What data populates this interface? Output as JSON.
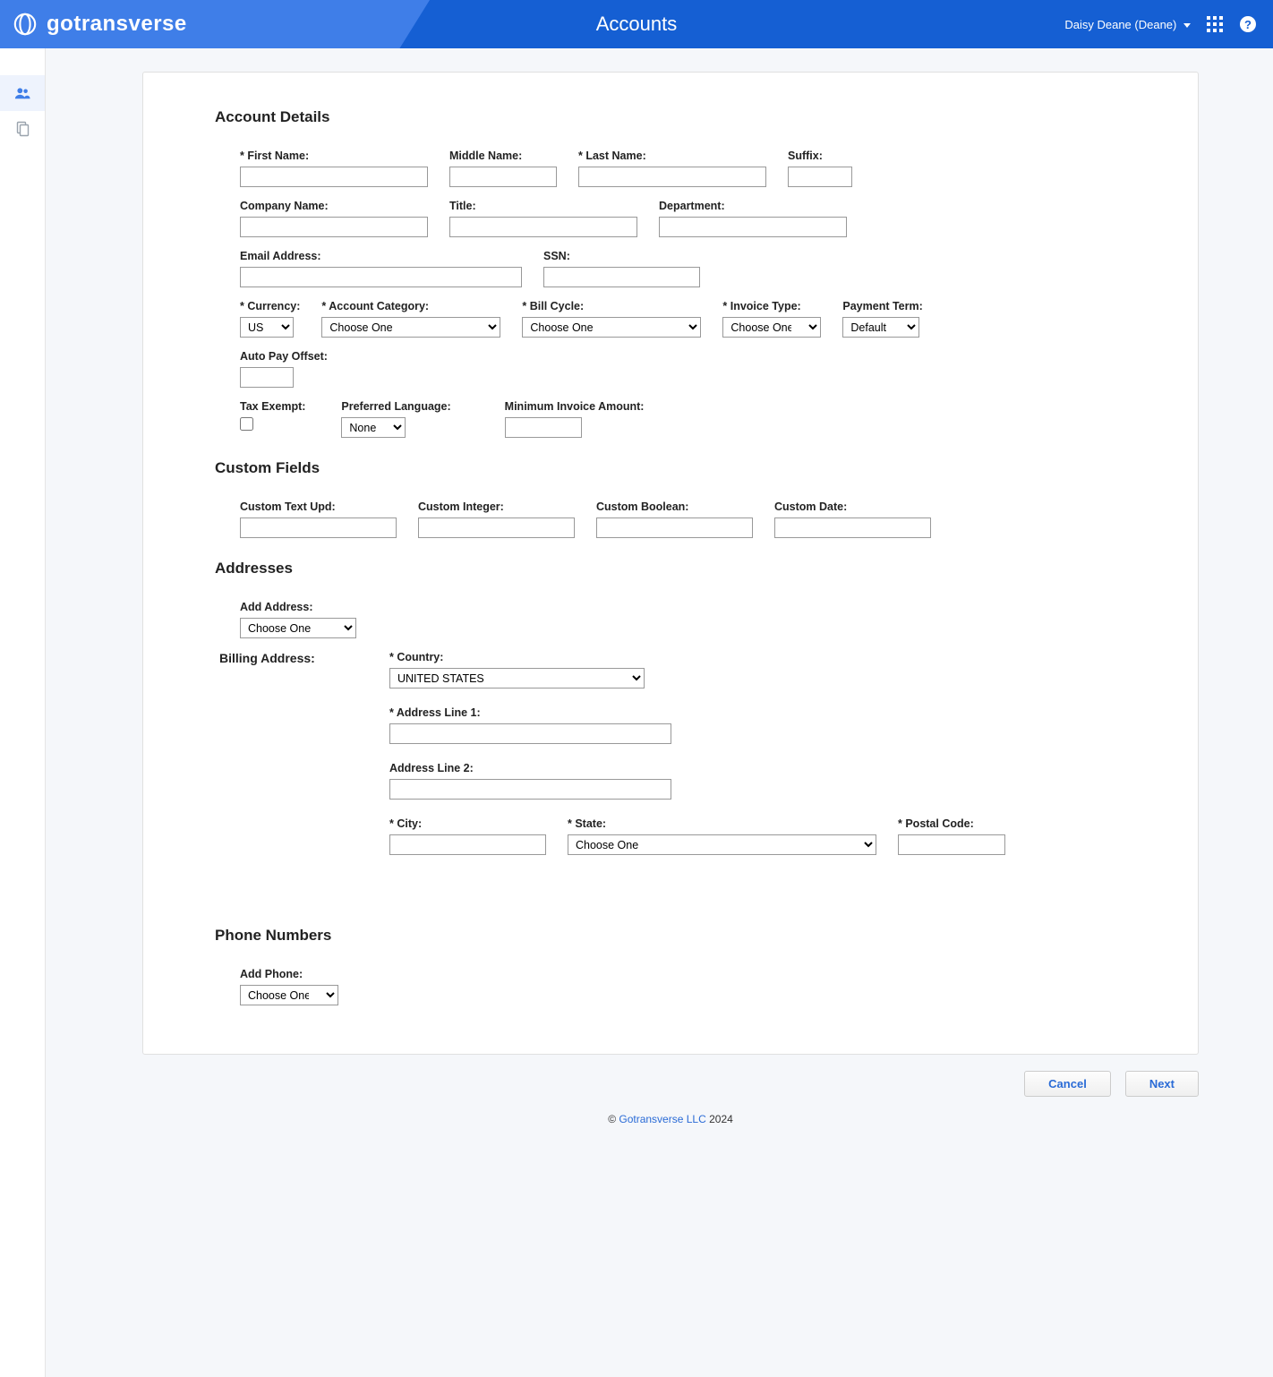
{
  "header": {
    "brand": "gotransverse",
    "title": "Accounts",
    "user_label": "Daisy Deane (Deane)"
  },
  "sections": {
    "account_details": "Account Details",
    "custom_fields": "Custom Fields",
    "addresses": "Addresses",
    "phone_numbers": "Phone Numbers"
  },
  "account": {
    "first_name_label": "First Name:",
    "first_name": "",
    "middle_name_label": "Middle Name:",
    "middle_name": "",
    "last_name_label": "Last Name:",
    "last_name": "",
    "suffix_label": "Suffix:",
    "suffix": "",
    "company_label": "Company Name:",
    "company": "",
    "title_label": "Title:",
    "title": "",
    "department_label": "Department:",
    "department": "",
    "email_label": "Email Address:",
    "email": "",
    "ssn_label": "SSN:",
    "ssn": "",
    "currency_label": "Currency:",
    "currency": "USD",
    "account_category_label": "Account Category:",
    "account_category": "Choose One",
    "bill_cycle_label": "Bill Cycle:",
    "bill_cycle": "Choose One",
    "invoice_type_label": "Invoice Type:",
    "invoice_type": "Choose One",
    "payment_term_label": "Payment Term:",
    "payment_term": "Default",
    "auto_pay_offset_label": "Auto Pay Offset:",
    "auto_pay_offset": "",
    "tax_exempt_label": "Tax Exempt:",
    "tax_exempt": false,
    "pref_lang_label": "Preferred Language:",
    "pref_lang": "None",
    "min_invoice_label": "Minimum Invoice Amount:",
    "min_invoice": ""
  },
  "custom": {
    "text_upd_label": "Custom Text Upd:",
    "text_upd": "",
    "integer_label": "Custom Integer:",
    "integer": "",
    "boolean_label": "Custom Boolean:",
    "boolean": "",
    "date_label": "Custom Date:",
    "date": ""
  },
  "addresses": {
    "add_address_label": "Add Address:",
    "add_address": "Choose One",
    "billing_label": "Billing Address:",
    "country_label": "Country:",
    "country": "UNITED STATES",
    "line1_label": "Address Line 1:",
    "line1": "",
    "line2_label": "Address Line 2:",
    "line2": "",
    "city_label": "City:",
    "city": "",
    "state_label": "State:",
    "state": "Choose One",
    "postal_label": "Postal Code:",
    "postal": ""
  },
  "phone": {
    "add_phone_label": "Add Phone:",
    "add_phone": "Choose One"
  },
  "buttons": {
    "cancel": "Cancel",
    "next": "Next"
  },
  "footer": {
    "copyright_symbol": "©",
    "link": "Gotransverse LLC",
    "year": "2024"
  }
}
